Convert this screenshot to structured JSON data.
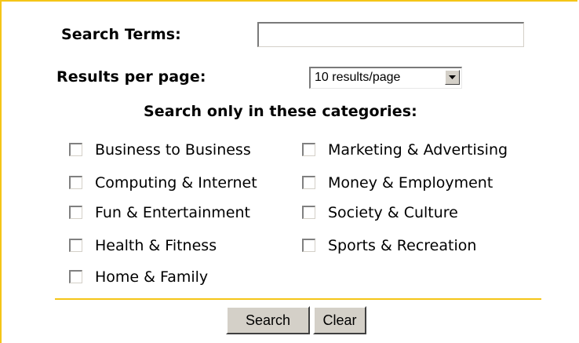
{
  "form": {
    "search_terms_label": "Search Terms:",
    "search_terms_value": "",
    "results_label": "Results per page:",
    "results_selected": "10 results/page",
    "categories_heading": "Search only in these categories:",
    "categories_left": [
      "Business to Business",
      "Computing & Internet",
      "Fun & Entertainment",
      "Health & Fitness",
      "Home & Family"
    ],
    "categories_right": [
      "Marketing & Advertising",
      "Money & Employment",
      "Society & Culture",
      "Sports & Recreation"
    ],
    "search_button": "Search",
    "clear_button": "Clear"
  },
  "colors": {
    "accent_border": "#f5c518",
    "button_face": "#d4d0c8"
  }
}
